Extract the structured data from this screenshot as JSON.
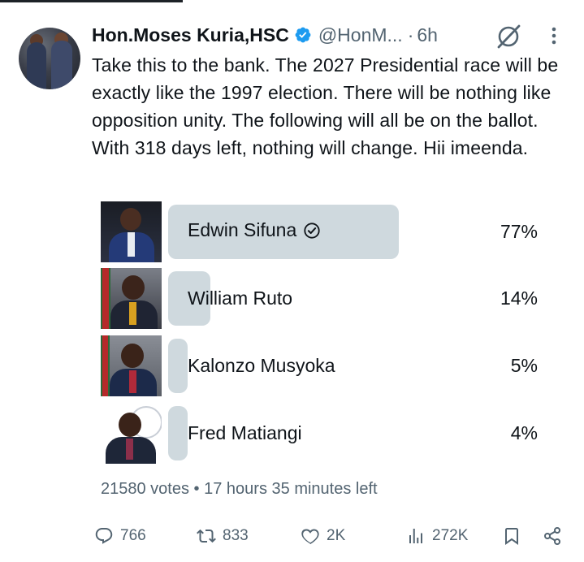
{
  "tweet": {
    "author_name": "Hon.Moses Kuria,HSC",
    "handle": "@HonM...",
    "separator": "·",
    "time": "6h",
    "text": "Take this to the bank. The 2027 Presidential race will be exactly like the 1997 election. There will be nothing like opposition unity. The following will all be on the ballot. With 318 days left, nothing will change. Hii imeenda."
  },
  "poll": {
    "options": [
      {
        "label": "Edwin Sifuna",
        "percent_label": "77%",
        "percent": 77,
        "leading": true
      },
      {
        "label": "William Ruto",
        "percent_label": "14%",
        "percent": 14,
        "leading": false
      },
      {
        "label": "Kalonzo Musyoka",
        "percent_label": "5%",
        "percent": 5,
        "leading": false
      },
      {
        "label": "Fred Matiangi",
        "percent_label": "4%",
        "percent": 4,
        "leading": false
      }
    ],
    "votes": "21580 votes",
    "meta_separator": "•",
    "time_left": "17 hours 35 minutes left"
  },
  "actions": {
    "replies": "766",
    "reposts": "833",
    "likes": "2K",
    "views": "272K"
  },
  "colors": {
    "verified": "#1d9bf0",
    "bar": "#cfd9de",
    "muted_text": "#536471",
    "text": "#0f1419"
  },
  "icons": [
    "verified-badge-icon",
    "grok-icon",
    "more-icon",
    "check-circle-icon",
    "reply-icon",
    "repost-icon",
    "like-icon",
    "views-icon",
    "bookmark-icon",
    "share-icon"
  ]
}
